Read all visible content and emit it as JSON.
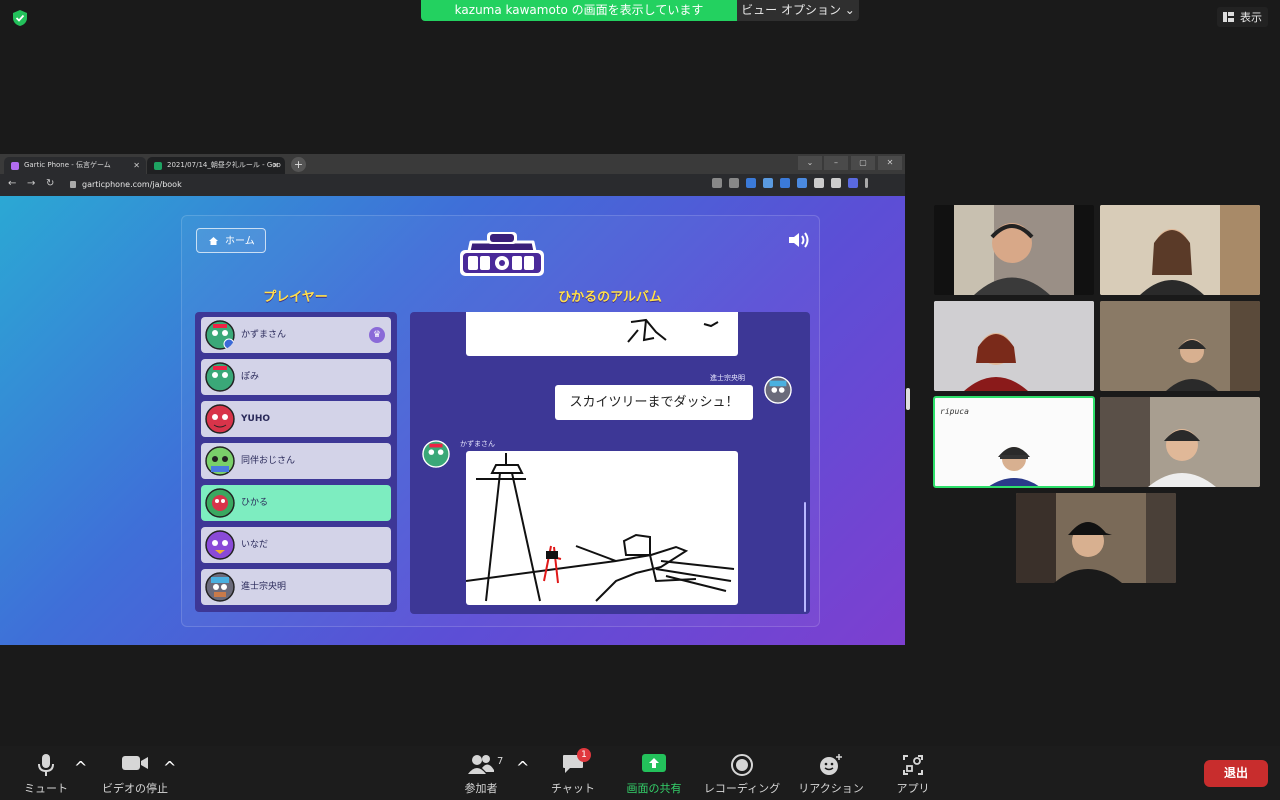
{
  "zoom": {
    "share_banner": "kazuma kawamoto の画面を表示しています",
    "view_options": "ビュー オプション ⌄",
    "view_button": "表示",
    "participants_count": "7",
    "chat_badge": "1",
    "toolbar": {
      "mute": "ミュート",
      "stop_video": "ビデオの停止",
      "participants": "参加者",
      "chat": "チャット",
      "share": "画面の共有",
      "record": "レコーディング",
      "reactions": "リアクション",
      "apps": "アプリ",
      "leave": "退出"
    },
    "tile_name_overlay": "ripuca"
  },
  "browser": {
    "tabs": [
      {
        "title": "Gartic Phone - 伝言ゲーム",
        "close": "✕"
      },
      {
        "title": "2021/07/14_朝昼夕礼ルール - Goo",
        "close": "✕"
      }
    ],
    "new_tab": "+",
    "url": "garticphone.com/ja/book"
  },
  "game": {
    "home_button": "ホーム",
    "players_heading": "プレイヤー",
    "album_heading": "ひかるのアルバム",
    "players": [
      {
        "name": "かずまさん",
        "owner": true
      },
      {
        "name": "ぽみ"
      },
      {
        "name": "YUHO"
      },
      {
        "name": "同伴おじさん"
      },
      {
        "name": "ひかる",
        "active": true
      },
      {
        "name": "いなだ"
      },
      {
        "name": "進士宗央明"
      }
    ],
    "album": {
      "text_author": "進士宗央明",
      "text_entry": "スカイツリーまでダッシュ！",
      "drawing_author": "かずまさん"
    }
  },
  "colors": {
    "zoom_green": "#23d160",
    "leave_red": "#c82d2d",
    "active_player": "#7dedc0",
    "heading_yellow": "#ffe04a"
  }
}
